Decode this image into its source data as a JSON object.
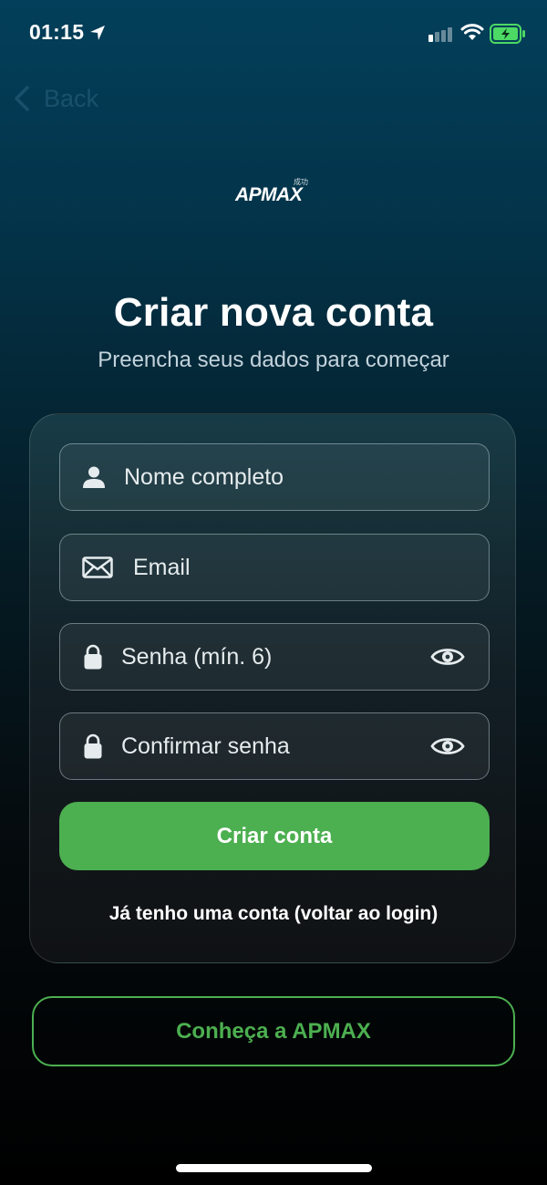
{
  "status_bar": {
    "time": "01:15",
    "icons": [
      "location-arrow-icon",
      "signal-icon",
      "wifi-icon",
      "battery-charging-icon"
    ]
  },
  "nav": {
    "back_label": "Back"
  },
  "logo": {
    "text": "APMAX",
    "superscript": "成功"
  },
  "header": {
    "title": "Criar nova conta",
    "subtitle": "Preencha seus dados para começar"
  },
  "form": {
    "fields": [
      {
        "icon": "person-icon",
        "placeholder": "Nome completo"
      },
      {
        "icon": "envelope-icon",
        "placeholder": "Email"
      },
      {
        "icon": "lock-icon",
        "placeholder": "Senha (mín. 6)",
        "trailing_icon": "eye-icon"
      },
      {
        "icon": "lock-icon",
        "placeholder": "Confirmar senha",
        "trailing_icon": "eye-icon"
      }
    ],
    "submit_label": "Criar conta",
    "login_link": "Já tenho uma conta (voltar ao login)"
  },
  "secondary": {
    "discover_label": "Conheça a APMAX"
  },
  "colors": {
    "accent": "#4caf50",
    "bg_top": "#033f5a",
    "bg_bottom": "#000000"
  }
}
